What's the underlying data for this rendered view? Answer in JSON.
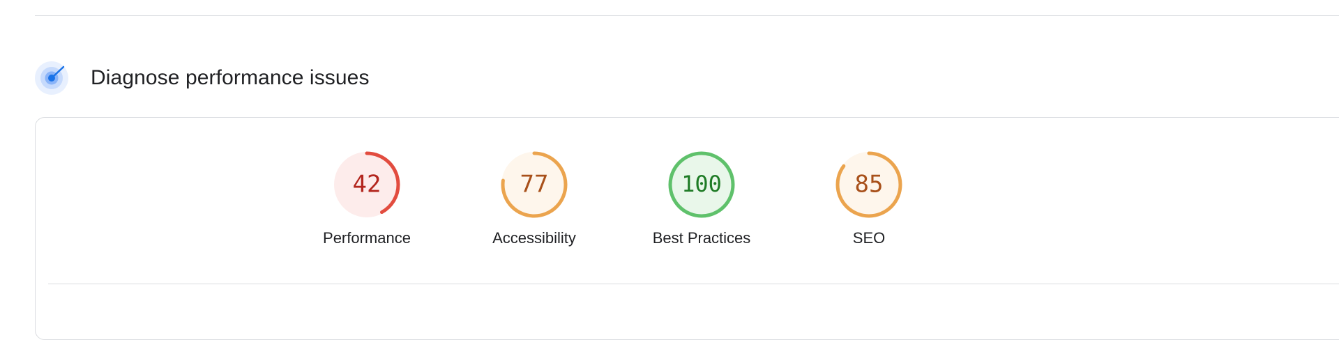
{
  "section": {
    "title": "Diagnose performance issues",
    "icon": "lighthouse-diagnostics-icon",
    "icon_color": "#1a73e8"
  },
  "scores": [
    {
      "name": "performance",
      "label": "Performance",
      "value": "42",
      "fraction": 0.42,
      "ring_color": "#e24c3f",
      "fill_color": "#fdeceb",
      "text_color": "#b3261e"
    },
    {
      "name": "accessibility",
      "label": "Accessibility",
      "value": "77",
      "fraction": 0.77,
      "ring_color": "#eba44e",
      "fill_color": "#fef6ec",
      "text_color": "#a8501a"
    },
    {
      "name": "best-practices",
      "label": "Best Practices",
      "value": "100",
      "fraction": 1.0,
      "ring_color": "#5fc16b",
      "fill_color": "#e9f7ea",
      "text_color": "#1e7b25"
    },
    {
      "name": "seo",
      "label": "SEO",
      "value": "85",
      "fraction": 0.85,
      "ring_color": "#eba44e",
      "fill_color": "#fef6ec",
      "text_color": "#a8501a"
    }
  ]
}
